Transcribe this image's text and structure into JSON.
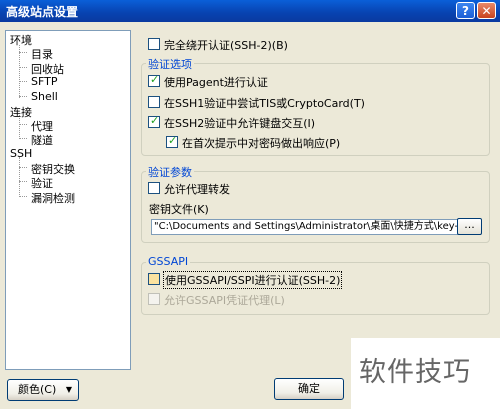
{
  "window": {
    "title": "高级站点设置",
    "help_label": "?",
    "close_label": "✕"
  },
  "tree": {
    "items": [
      "环境",
      "目录",
      "回收站",
      "SFTP",
      "Shell",
      "连接",
      "代理",
      "隧道",
      "SSH",
      "密钥交换",
      "验证",
      "漏洞检测"
    ]
  },
  "top_option": {
    "label": "完全绕开认证(SSH-2)(B)",
    "checked": false
  },
  "verify_options": {
    "title": "验证选项",
    "items": [
      {
        "label": "使用Pagent进行认证",
        "checked": true
      },
      {
        "label": "在SSH1验证中尝试TIS或CryptoCard(T)",
        "checked": false
      },
      {
        "label": "在SSH2验证中允许键盘交互(I)",
        "checked": true
      },
      {
        "label": "在首次提示中对密码做出响应(P)",
        "checked": true
      }
    ]
  },
  "verify_params": {
    "title": "验证参数",
    "agent_forward_label": "允许代理转发",
    "agent_forward_checked": false,
    "keyfile_label": "密钥文件(K)",
    "keyfile_value": "\"C:\\Documents and Settings\\Administrator\\桌面\\快捷方式\\key-home.p",
    "browse_label": "..."
  },
  "gssapi": {
    "title": "GSSAPI",
    "items": [
      {
        "label": "使用GSSAPI/SSPI进行认证(SSH-2)",
        "checked": false
      },
      {
        "label": "允许GSSAPI凭证代理(L)",
        "checked": false,
        "disabled": true
      }
    ]
  },
  "buttons": {
    "color": "颜色(C)",
    "color_arrow": "▼",
    "ok": "确定"
  },
  "watermark_text": "软件技巧"
}
